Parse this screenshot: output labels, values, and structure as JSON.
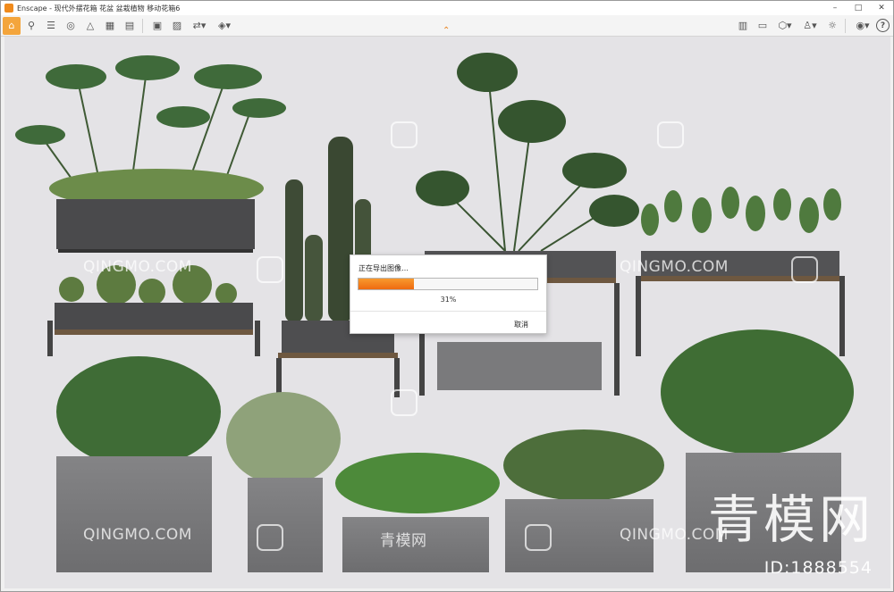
{
  "window": {
    "title": "Enscape - 现代外摆花箱 花盆 盆栽植物 移动花箱6",
    "controls": {
      "minimize": "–",
      "maximize": "□",
      "close": "✕"
    }
  },
  "toolbar": {
    "left_icons": [
      "home-icon",
      "asset-library-icon",
      "views-icon",
      "capture-icon",
      "visual-settings-icon",
      "batch-render-icon",
      "export-icon",
      "video-editor-icon",
      "image-export-icon",
      "panorama-icon",
      "web-standalone-icon"
    ],
    "right_icons": [
      "map-icon",
      "layers-icon",
      "object-icon",
      "character-icon",
      "sun-icon",
      "vr-icon",
      "help-icon"
    ],
    "help_label": "?"
  },
  "dialog": {
    "message": "正在导出图像…",
    "progress_text": "31%",
    "progress": 0.31,
    "cancel_label": "取消",
    "accent": "#ee6a10"
  },
  "watermarks": {
    "site": "QINGMO.COM",
    "site_cn": "青模网",
    "brand_big": "青模网",
    "id_label": "ID:1888554"
  },
  "colors": {
    "accent": "#f4a53c",
    "viewport_bg": "#e4e3e6",
    "planter": "#7b7b7d",
    "planter_dark": "#4a4a4c"
  }
}
